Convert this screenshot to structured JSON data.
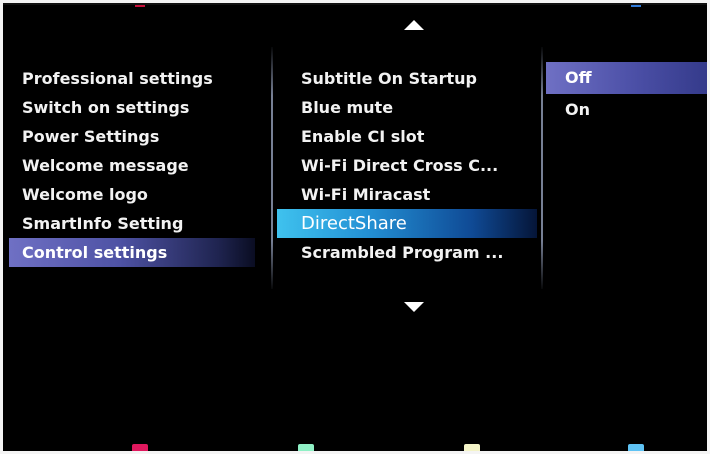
{
  "menu": {
    "col1": [
      {
        "label": "Professional settings"
      },
      {
        "label": "Switch on settings"
      },
      {
        "label": "Power Settings"
      },
      {
        "label": "Welcome message"
      },
      {
        "label": "Welcome logo"
      },
      {
        "label": "SmartInfo Setting"
      },
      {
        "label": "Control settings"
      }
    ],
    "col2": [
      {
        "label": "Subtitle On Startup"
      },
      {
        "label": "Blue mute"
      },
      {
        "label": "Enable CI slot"
      },
      {
        "label": "Wi-Fi Direct Cross C..."
      },
      {
        "label": "Wi-Fi Miracast"
      },
      {
        "label": "DirectShare"
      },
      {
        "label": "Scrambled Program ..."
      }
    ],
    "col3": [
      {
        "label": "Off"
      },
      {
        "label": "On"
      }
    ],
    "active_col1": "Control settings",
    "focused_col2": "DirectShare",
    "selected_col3": "Off"
  },
  "icons": {
    "scroll_up": "triangle-up",
    "scroll_down": "triangle-down"
  },
  "color_keys": {
    "red": "#e0185e",
    "green": "#8ff0c5",
    "yellow": "#f4f4c8",
    "blue": "#5fc3f4"
  },
  "colors": {
    "background": "#000000",
    "text": "#f2f2f2",
    "active_highlight": "#5457ab",
    "focus_highlight": "#2aa6e2"
  }
}
